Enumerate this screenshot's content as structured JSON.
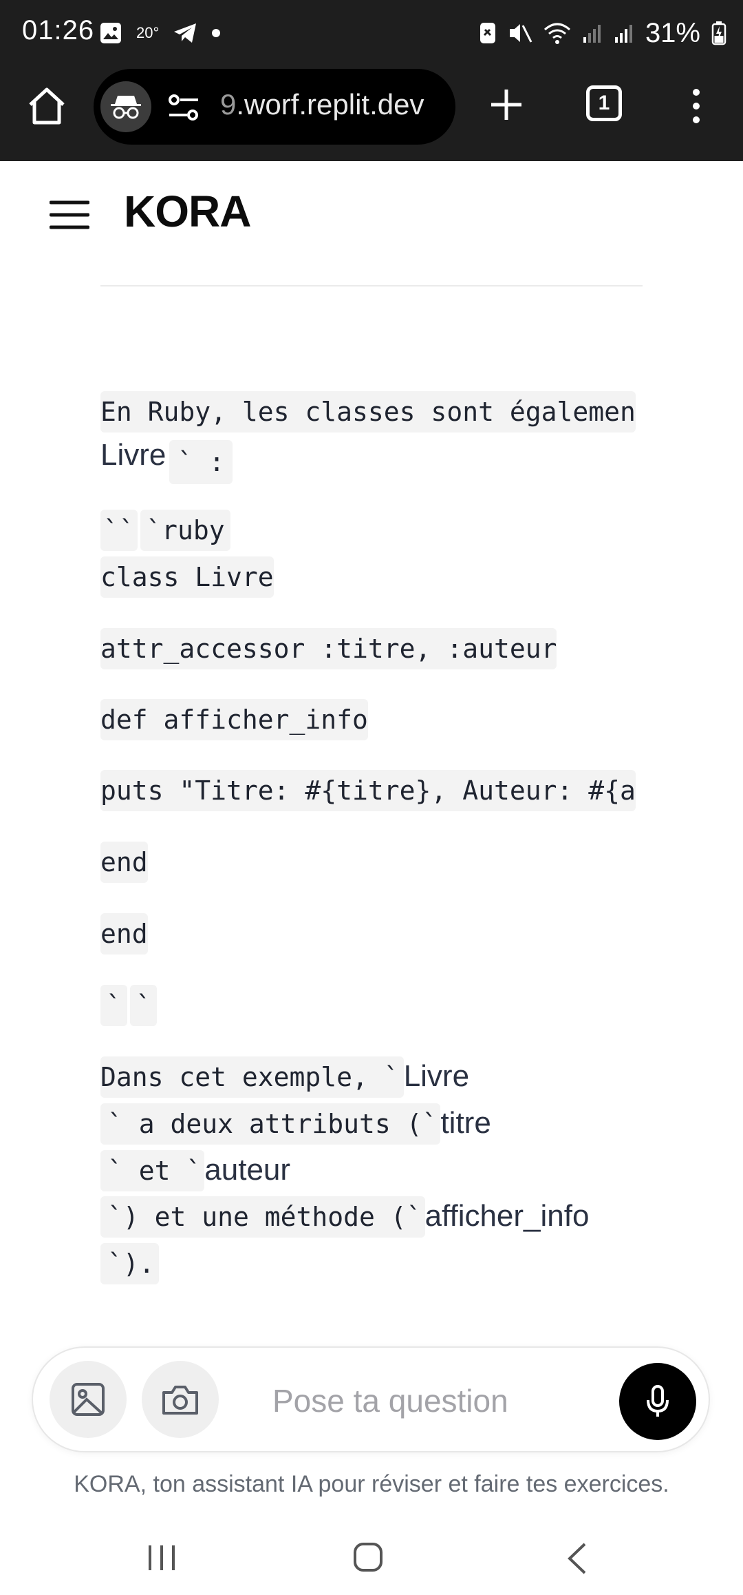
{
  "status_bar": {
    "time": "01:26",
    "temperature": "20°",
    "battery": "31%"
  },
  "browser": {
    "url_prefix": "9",
    "url_rest": ".worf.replit.dev",
    "tab_count": "1"
  },
  "app": {
    "title": "KORA"
  },
  "content": {
    "intro_code": "En Ruby, les classes sont égalemen",
    "intro_word": "Livre",
    "intro_tail": "` :",
    "fence_ticks": "``",
    "fence_lang": "`ruby",
    "code_lines": [
      "class Livre",
      "attr_accessor :titre, :auteur",
      "def afficher_info",
      "puts \"Titre: #{titre}, Auteur: #{a",
      "end",
      "end"
    ],
    "fence_close_a": "`",
    "fence_close_b": "`",
    "expl_1_code": "Dans cet exemple, `",
    "expl_1_word": "Livre",
    "expl_2_code": "` a deux attributs (`",
    "expl_2_word": "titre",
    "expl_3_code": "` et `",
    "expl_3_word": "auteur",
    "expl_4_code": "`) et une méthode (`",
    "expl_4_word": "afficher_info",
    "expl_5_code": "`)."
  },
  "composer": {
    "placeholder": "Pose ta question",
    "footer": "KORA, ton assistant IA pour réviser et faire tes exercices."
  },
  "icons": {
    "home": "home-icon",
    "incognito": "incognito-icon",
    "site_settings": "tune-icon",
    "new_tab": "plus-icon",
    "menu": "more-vert-icon",
    "hamburger": "hamburger-icon",
    "image": "image-icon",
    "camera": "camera-icon",
    "mic": "mic-icon"
  }
}
